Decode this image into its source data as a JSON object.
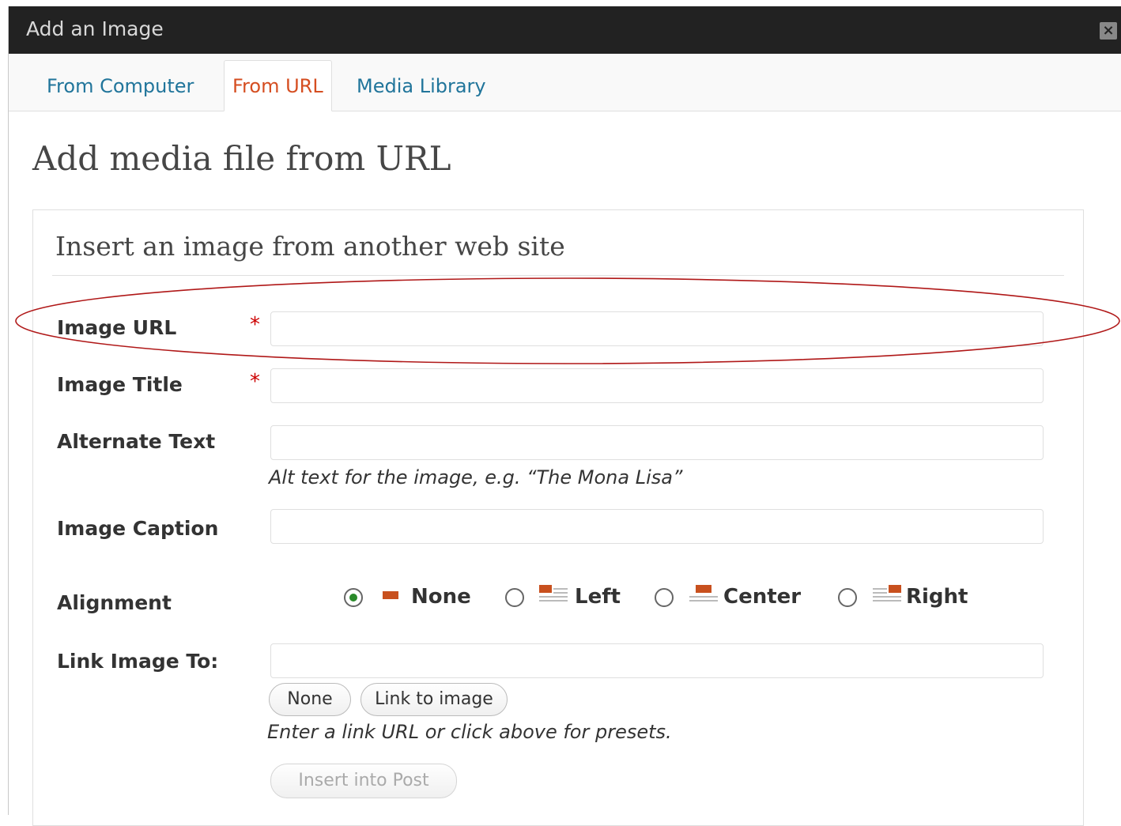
{
  "dialog": {
    "title": "Add an Image",
    "close_icon": "close-icon"
  },
  "tabs": [
    {
      "label": "From Computer",
      "active": false
    },
    {
      "label": "From URL",
      "active": true
    },
    {
      "label": "Media Library",
      "active": false
    }
  ],
  "page_title": "Add media file from URL",
  "panel": {
    "heading": "Insert an image from another web site"
  },
  "form": {
    "image_url": {
      "label": "Image URL",
      "required_mark": "*",
      "value": ""
    },
    "image_title": {
      "label": "Image Title",
      "required_mark": "*",
      "value": ""
    },
    "alt_text": {
      "label": "Alternate Text",
      "value": "",
      "help": "Alt text for the image, e.g. “The Mona Lisa”"
    },
    "caption": {
      "label": "Image Caption",
      "value": ""
    },
    "alignment": {
      "label": "Alignment",
      "options": [
        {
          "label": "None",
          "checked": true
        },
        {
          "label": "Left",
          "checked": false
        },
        {
          "label": "Center",
          "checked": false
        },
        {
          "label": "Right",
          "checked": false
        }
      ]
    },
    "link": {
      "label": "Link Image To:",
      "value": "",
      "none_button": "None",
      "link_button": "Link to image",
      "help": "Enter a link URL or click above for presets."
    },
    "insert_button": "Insert into Post"
  },
  "colors": {
    "titlebar": "#222222",
    "tab_link": "#21759b",
    "tab_active": "#d54e21",
    "required": "#cc0000",
    "annotation": "#b01818"
  }
}
